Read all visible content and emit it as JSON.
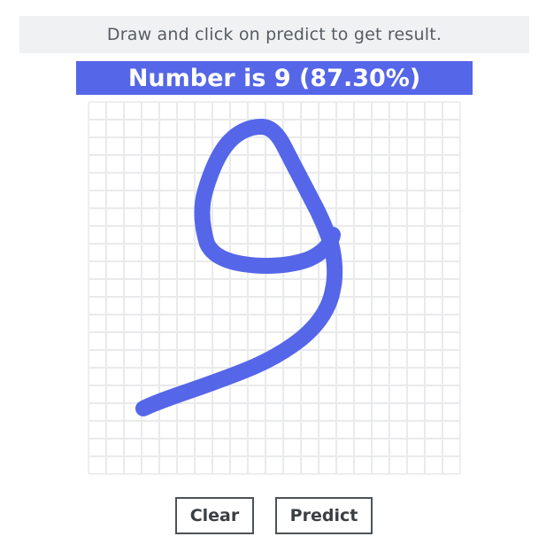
{
  "instruction": {
    "text": "Draw and click on predict to get result."
  },
  "result": {
    "text": "Number is 9 (87.30%)"
  },
  "canvas": {
    "stroke_color": "#5566e8",
    "grid_color": "#e9eaec"
  },
  "buttons": {
    "clear_label": "Clear",
    "predict_label": "Predict"
  },
  "colors": {
    "accent": "#5566e8",
    "instruction_bg": "#f0f1f2"
  }
}
